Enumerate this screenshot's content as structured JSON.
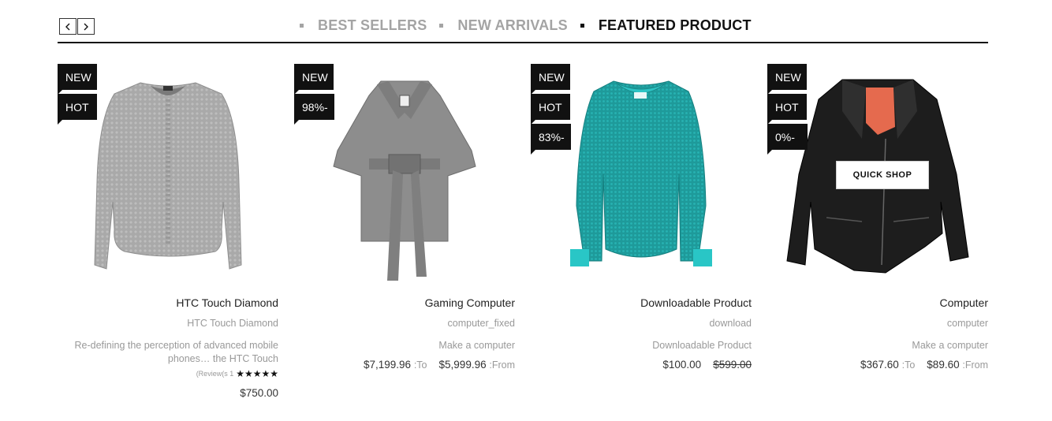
{
  "nav": {
    "prev_icon": "chevron-left-icon",
    "next_icon": "chevron-right-icon"
  },
  "tabs": [
    {
      "label": "BEST SELLERS",
      "active": false
    },
    {
      "label": "NEW ARRIVALS",
      "active": false
    },
    {
      "label": "FEATURED PRODUCT",
      "active": true
    }
  ],
  "products": [
    {
      "badges": [
        "NEW",
        "HOT"
      ],
      "image": "grey-knit-sweater",
      "title": "HTC Touch Diamond",
      "subtitle": "HTC Touch Diamond",
      "description": "Re-defining the perception of advanced mobile phones… the HTC Touch",
      "rating_text": "(Review(s 1",
      "rating_stars": "★★★★★",
      "price": "$750.00"
    },
    {
      "badges": [
        "NEW",
        "98%-"
      ],
      "image": "grey-belted-coat",
      "title": "Gaming Computer",
      "subtitle": "computer_fixed",
      "description": "Make a computer",
      "price_high": "$7,199.96",
      "price_high_label": ":To",
      "price_low": "$5,999.96",
      "price_low_label": ":From"
    },
    {
      "badges": [
        "NEW",
        "HOT",
        "83%-"
      ],
      "image": "teal-long-sleeve-top",
      "title": "Downloadable Product",
      "subtitle": "download",
      "description": "Downloadable Product",
      "price": "$100.00",
      "old_price": "$599.00"
    },
    {
      "badges": [
        "NEW",
        "HOT",
        "0%-"
      ],
      "image": "black-leather-jacket",
      "quick_shop": "QUICK SHOP",
      "title": "Computer",
      "subtitle": "computer",
      "description": "Make a computer",
      "price_high": "$367.60",
      "price_high_label": ":To",
      "price_low": "$89.60",
      "price_low_label": ":From"
    }
  ]
}
